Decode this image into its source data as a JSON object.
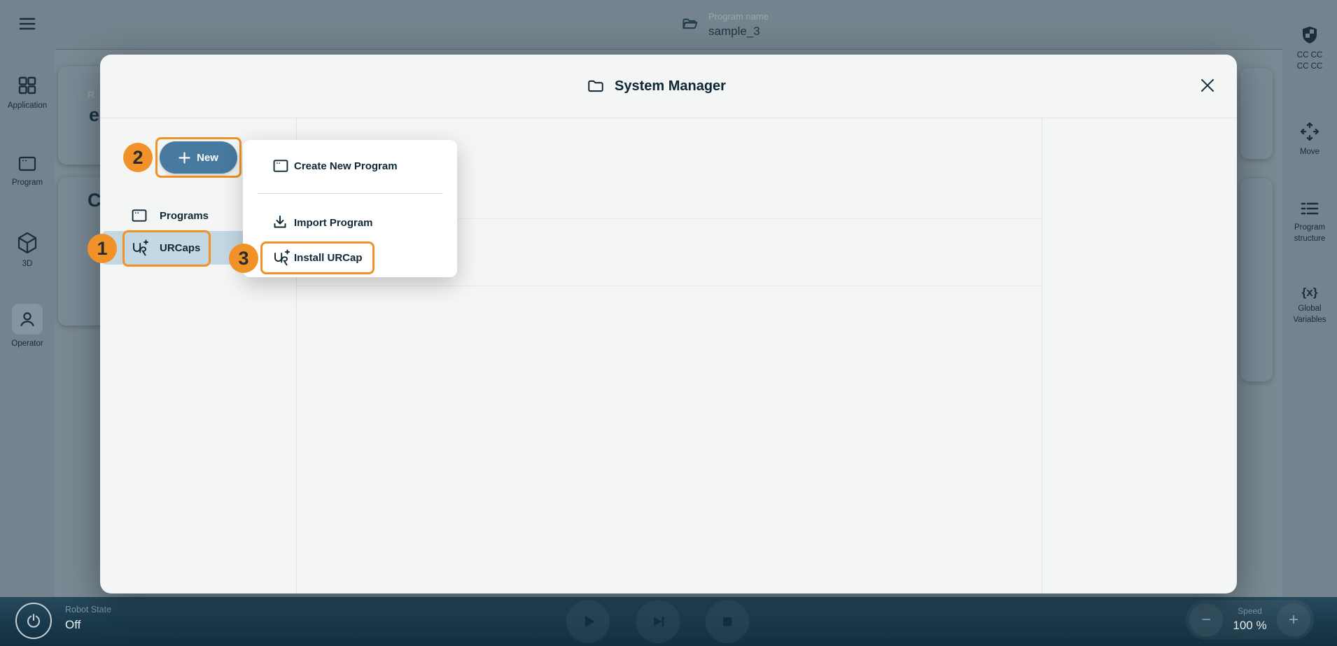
{
  "topbar": {
    "program_label": "Program name",
    "program_value": "sample_3"
  },
  "left_sidebar": {
    "items": [
      {
        "label": "Application"
      },
      {
        "label": "Program"
      },
      {
        "label": "3D"
      },
      {
        "label": "Operator"
      }
    ]
  },
  "right_sidebar": {
    "safety_line1": "CC CC",
    "safety_line2": "CC CC",
    "move_label": "Move",
    "structure_line1": "Program",
    "structure_line2": "structure",
    "variables_symbol": "{x}",
    "variables_line1": "Global",
    "variables_line2": "Variables"
  },
  "background": {
    "card1_label": "R",
    "card1_text": "e",
    "card2_text": "C"
  },
  "modal": {
    "title": "System Manager",
    "nav": {
      "new_button": "New",
      "programs": "Programs",
      "urcaps": "URCaps"
    },
    "menu": {
      "create": "Create New Program",
      "import": "Import Program",
      "install": "Install URCap"
    }
  },
  "annotations": {
    "step1": "1",
    "step2": "2",
    "step3": "3"
  },
  "bottom_bar": {
    "robot_state_label": "Robot State",
    "robot_state_value": "Off",
    "speed_label": "Speed",
    "speed_value": "100 %",
    "minus": "−",
    "plus": "+"
  },
  "colors": {
    "accent_orange": "#F09227",
    "button_blue": "#48799F",
    "selected_row": "#C4D8E4",
    "dark_teal": "#16303D",
    "bottom_bar": "#1A3A4C"
  }
}
